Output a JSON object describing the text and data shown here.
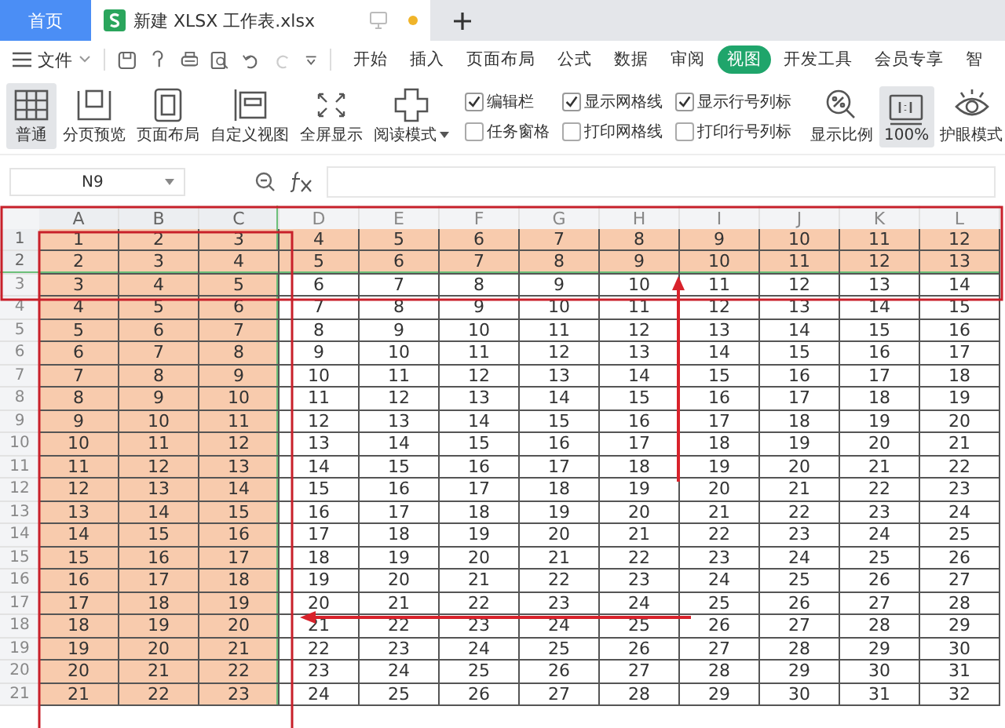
{
  "tabs": [
    {
      "label": "首页",
      "kind": "home",
      "selected": false
    },
    {
      "label": "新建 XLSX 工作表.xlsx",
      "kind": "doc",
      "selected": true
    }
  ],
  "menu": {
    "file": "文件",
    "ribbon_tabs": [
      {
        "label": "开始",
        "selected": false
      },
      {
        "label": "插入",
        "selected": false
      },
      {
        "label": "页面布局",
        "selected": false
      },
      {
        "label": "公式",
        "selected": false
      },
      {
        "label": "数据",
        "selected": false
      },
      {
        "label": "审阅",
        "selected": false
      },
      {
        "label": "视图",
        "selected": true
      },
      {
        "label": "开发工具",
        "selected": false
      },
      {
        "label": "会员专享",
        "selected": false
      },
      {
        "label": "智",
        "selected": false
      }
    ]
  },
  "ribbon": {
    "views": [
      {
        "label": "普通",
        "kind": "grid",
        "selected": true
      },
      {
        "label": "分页预览",
        "kind": "page",
        "selected": false
      },
      {
        "label": "页面布局",
        "kind": "layout",
        "selected": false
      },
      {
        "label": "自定义视图",
        "kind": "custom",
        "selected": false
      },
      {
        "label": "全屏显示",
        "kind": "fullscreen",
        "selected": false
      },
      {
        "label": "阅读模式",
        "kind": "read",
        "selected": false,
        "dropdown": true
      }
    ],
    "checkboxes": [
      {
        "label": "编辑栏",
        "checked": true
      },
      {
        "label": "任务窗格",
        "checked": false
      },
      {
        "label": "显示网格线",
        "checked": true
      },
      {
        "label": "打印网格线",
        "checked": false
      },
      {
        "label": "显示行号列标",
        "checked": true
      },
      {
        "label": "打印行号列标",
        "checked": false
      }
    ],
    "tools": [
      {
        "label": "显示比例",
        "kind": "zoom",
        "selected": false
      },
      {
        "label": "100%",
        "kind": "onetoone",
        "selected": true
      },
      {
        "label": "护眼模式",
        "kind": "eye",
        "selected": false
      }
    ]
  },
  "formula_bar": {
    "name_box": "N9"
  },
  "sheet": {
    "columns": [
      {
        "label": "A",
        "highlighted": true,
        "freeze_line": false
      },
      {
        "label": "B",
        "highlighted": true,
        "freeze_line": false
      },
      {
        "label": "C",
        "highlighted": true,
        "freeze_line": true
      },
      {
        "label": "D",
        "highlighted": false,
        "freeze_line": false
      },
      {
        "label": "E",
        "highlighted": false,
        "freeze_line": false
      },
      {
        "label": "F",
        "highlighted": false,
        "freeze_line": false
      },
      {
        "label": "G",
        "highlighted": false,
        "freeze_line": false
      },
      {
        "label": "H",
        "highlighted": false,
        "freeze_line": false
      },
      {
        "label": "I",
        "highlighted": false,
        "freeze_line": false
      },
      {
        "label": "J",
        "highlighted": false,
        "freeze_line": false
      },
      {
        "label": "K",
        "highlighted": false,
        "freeze_line": false
      },
      {
        "label": "L",
        "highlighted": false,
        "freeze_line": false
      }
    ],
    "rows": [
      {
        "header": "1",
        "highlighted": true,
        "freeze_line": false,
        "cells": [
          "1",
          "2",
          "3",
          "4",
          "5",
          "6",
          "7",
          "8",
          "9",
          "10",
          "11",
          "12"
        ]
      },
      {
        "header": "2",
        "highlighted": true,
        "freeze_line": true,
        "cells": [
          "2",
          "3",
          "4",
          "5",
          "6",
          "7",
          "8",
          "9",
          "10",
          "11",
          "12",
          "13"
        ]
      },
      {
        "header": "3",
        "highlighted": false,
        "freeze_line": false,
        "cells": [
          "3",
          "4",
          "5",
          "6",
          "7",
          "8",
          "9",
          "10",
          "11",
          "12",
          "13",
          "14"
        ]
      },
      {
        "header": "4",
        "highlighted": false,
        "freeze_line": false,
        "cells": [
          "4",
          "5",
          "6",
          "7",
          "8",
          "9",
          "10",
          "11",
          "12",
          "13",
          "14",
          "15"
        ]
      },
      {
        "header": "5",
        "highlighted": false,
        "freeze_line": false,
        "cells": [
          "5",
          "6",
          "7",
          "8",
          "9",
          "10",
          "11",
          "12",
          "13",
          "14",
          "15",
          "16"
        ]
      },
      {
        "header": "6",
        "highlighted": false,
        "freeze_line": false,
        "cells": [
          "6",
          "7",
          "8",
          "9",
          "10",
          "11",
          "12",
          "13",
          "14",
          "15",
          "16",
          "17"
        ]
      },
      {
        "header": "7",
        "highlighted": false,
        "freeze_line": false,
        "cells": [
          "7",
          "8",
          "9",
          "10",
          "11",
          "12",
          "13",
          "14",
          "15",
          "16",
          "17",
          "18"
        ]
      },
      {
        "header": "8",
        "highlighted": false,
        "freeze_line": false,
        "cells": [
          "8",
          "9",
          "10",
          "11",
          "12",
          "13",
          "14",
          "15",
          "16",
          "17",
          "18",
          "19"
        ]
      },
      {
        "header": "9",
        "highlighted": false,
        "freeze_line": false,
        "cells": [
          "9",
          "10",
          "11",
          "12",
          "13",
          "14",
          "15",
          "16",
          "17",
          "18",
          "19",
          "20"
        ]
      },
      {
        "header": "10",
        "highlighted": false,
        "freeze_line": false,
        "cells": [
          "10",
          "11",
          "12",
          "13",
          "14",
          "15",
          "16",
          "17",
          "18",
          "19",
          "20",
          "21"
        ]
      },
      {
        "header": "11",
        "highlighted": false,
        "freeze_line": false,
        "cells": [
          "11",
          "12",
          "13",
          "14",
          "15",
          "16",
          "17",
          "18",
          "19",
          "20",
          "21",
          "22"
        ]
      },
      {
        "header": "12",
        "highlighted": false,
        "freeze_line": false,
        "cells": [
          "12",
          "13",
          "14",
          "15",
          "16",
          "17",
          "18",
          "19",
          "20",
          "21",
          "22",
          "23"
        ]
      },
      {
        "header": "13",
        "highlighted": false,
        "freeze_line": false,
        "cells": [
          "13",
          "14",
          "15",
          "16",
          "17",
          "18",
          "19",
          "20",
          "21",
          "22",
          "23",
          "24"
        ]
      },
      {
        "header": "14",
        "highlighted": false,
        "freeze_line": false,
        "cells": [
          "14",
          "15",
          "16",
          "17",
          "18",
          "19",
          "20",
          "21",
          "22",
          "23",
          "24",
          "25"
        ]
      },
      {
        "header": "15",
        "highlighted": false,
        "freeze_line": false,
        "cells": [
          "15",
          "16",
          "17",
          "18",
          "19",
          "20",
          "21",
          "22",
          "23",
          "24",
          "25",
          "26"
        ]
      },
      {
        "header": "16",
        "highlighted": false,
        "freeze_line": false,
        "cells": [
          "16",
          "17",
          "18",
          "19",
          "20",
          "21",
          "22",
          "23",
          "24",
          "25",
          "26",
          "27"
        ]
      },
      {
        "header": "17",
        "highlighted": false,
        "freeze_line": false,
        "cells": [
          "17",
          "18",
          "19",
          "20",
          "21",
          "22",
          "23",
          "24",
          "25",
          "26",
          "27",
          "28"
        ]
      },
      {
        "header": "18",
        "highlighted": false,
        "freeze_line": false,
        "cells": [
          "18",
          "19",
          "20",
          "21",
          "22",
          "23",
          "24",
          "25",
          "26",
          "27",
          "28",
          "29"
        ]
      },
      {
        "header": "19",
        "highlighted": false,
        "freeze_line": false,
        "cells": [
          "19",
          "20",
          "21",
          "22",
          "23",
          "24",
          "25",
          "26",
          "27",
          "28",
          "29",
          "30"
        ]
      },
      {
        "header": "20",
        "highlighted": false,
        "freeze_line": false,
        "cells": [
          "20",
          "21",
          "22",
          "23",
          "24",
          "25",
          "26",
          "27",
          "28",
          "29",
          "30",
          "31"
        ]
      },
      {
        "header": "21",
        "highlighted": false,
        "freeze_line": false,
        "cells": [
          "21",
          "22",
          "23",
          "24",
          "25",
          "26",
          "27",
          "28",
          "29",
          "30",
          "31",
          "32"
        ]
      }
    ]
  }
}
